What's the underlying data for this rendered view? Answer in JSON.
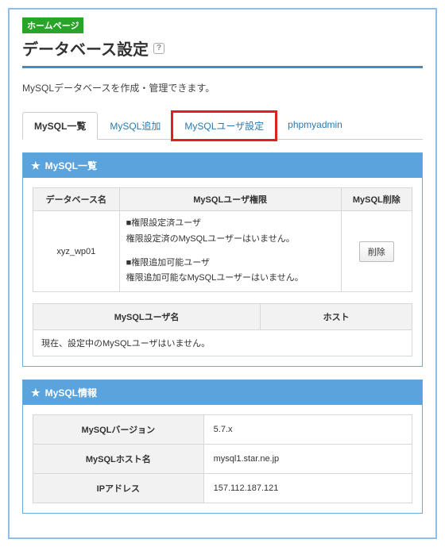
{
  "badge": "ホームページ",
  "page_title": "データベース設定",
  "intro": "MySQLデータベースを作成・管理できます。",
  "tabs": {
    "list": "MySQL一覧",
    "add": "MySQL追加",
    "user": "MySQLユーザ設定",
    "phpmy": "phpmyadmin"
  },
  "panel_list": {
    "title": "MySQL一覧",
    "cols": {
      "dbname": "データベース名",
      "userperm": "MySQLユーザ権限",
      "delete": "MySQL削除"
    },
    "row": {
      "dbname": "xyz_wp01",
      "perm_set_label": "■権限設定済ユーザ",
      "perm_set_msg": "権限設定済のMySQLユーザーはいません。",
      "perm_add_label": "■権限追加可能ユーザ",
      "perm_add_msg": "権限追加可能なMySQLユーザーはいません。",
      "delete_btn": "削除"
    },
    "sub_cols": {
      "username": "MySQLユーザ名",
      "host": "ホスト"
    },
    "sub_empty": "現在、設定中のMySQLユーザはいません。"
  },
  "panel_info": {
    "title": "MySQL情報",
    "rows": {
      "version_label": "MySQLバージョン",
      "version_value": "5.7.x",
      "host_label": "MySQLホスト名",
      "host_value": "mysql1.star.ne.jp",
      "ip_label": "IPアドレス",
      "ip_value": "157.112.187.121"
    }
  }
}
